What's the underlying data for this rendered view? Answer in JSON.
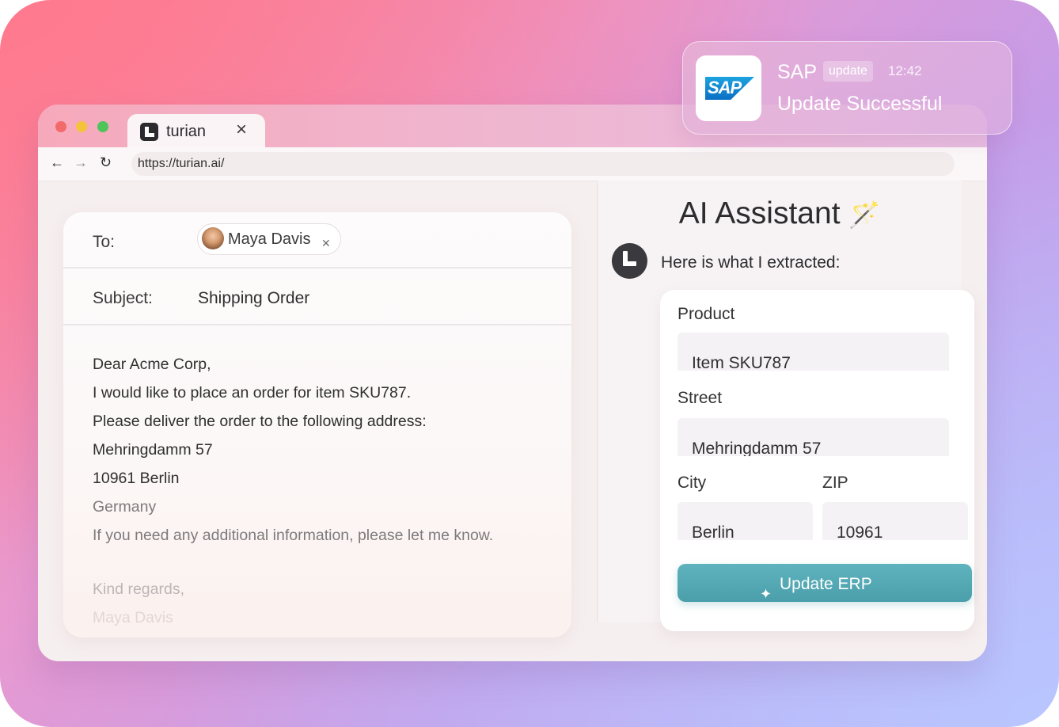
{
  "browser": {
    "tab_title": "turian",
    "url": "https://turian.ai/",
    "icons": {
      "close": "close-icon",
      "back": "arrow-left-icon",
      "forward": "arrow-right-icon",
      "reload": "reload-icon"
    }
  },
  "email": {
    "to_label": "To:",
    "recipient": "Maya Davis",
    "subject_label": "Subject:",
    "subject": "Shipping Order",
    "body": [
      "Dear Acme Corp,",
      "I would like to place an order for item SKU787.",
      "Please deliver the order to the following address:",
      "Mehringdamm 57",
      "10961 Berlin",
      "Germany",
      "If you need any additional information, please let me know.",
      "Kind regards,",
      "Maya Davis"
    ]
  },
  "assistant": {
    "title": "AI Assistant",
    "message": "Here is what I extracted:",
    "fields": {
      "product_label": "Product",
      "product": "Item SKU787",
      "street_label": "Street",
      "street": "Mehringdamm 57",
      "city_label": "City",
      "city": "Berlin",
      "zip_label": "ZIP",
      "zip": "10961"
    },
    "button": "Update ERP"
  },
  "notification": {
    "app": "SAP",
    "badge": "update",
    "time": "12:42",
    "message": "Update Successful",
    "logo_text": "SAP"
  },
  "colors": {
    "accent_button": "#55aab5",
    "sap_blue": "#0b6fc4"
  }
}
